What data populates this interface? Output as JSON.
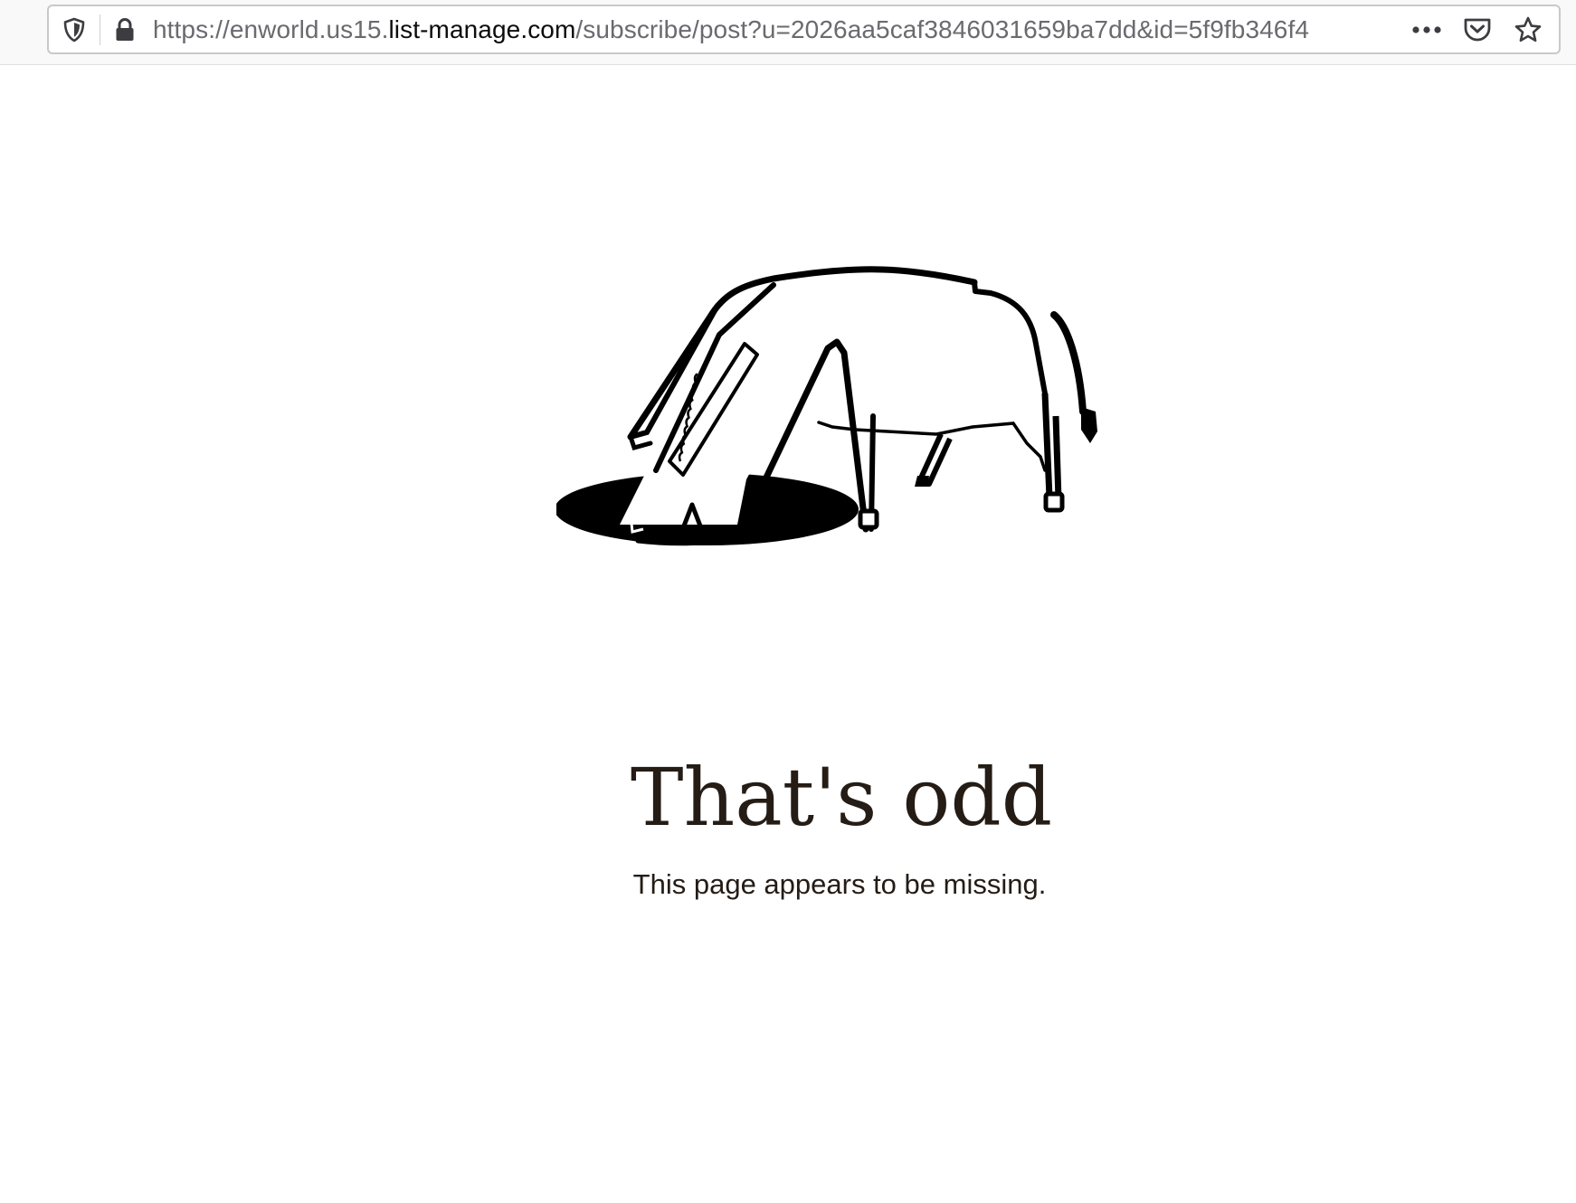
{
  "browser": {
    "url": {
      "prefix": "https://enworld.us15.",
      "domain": "list-manage.com",
      "suffix": "/subscribe/post?u=2026aa5caf3846031659ba7dd&id=5f9fb346f4"
    },
    "icons": {
      "tracking": "shield-icon",
      "security": "lock-icon",
      "menu": "more-dots-icon",
      "pocket": "pocket-icon",
      "bookmark": "star-icon"
    }
  },
  "page": {
    "heading": "That's odd",
    "message": "This page appears to be missing."
  },
  "colors": {
    "text": "#241c15",
    "url_muted": "#6a6a6f",
    "url_domain": "#0c0c0d"
  }
}
